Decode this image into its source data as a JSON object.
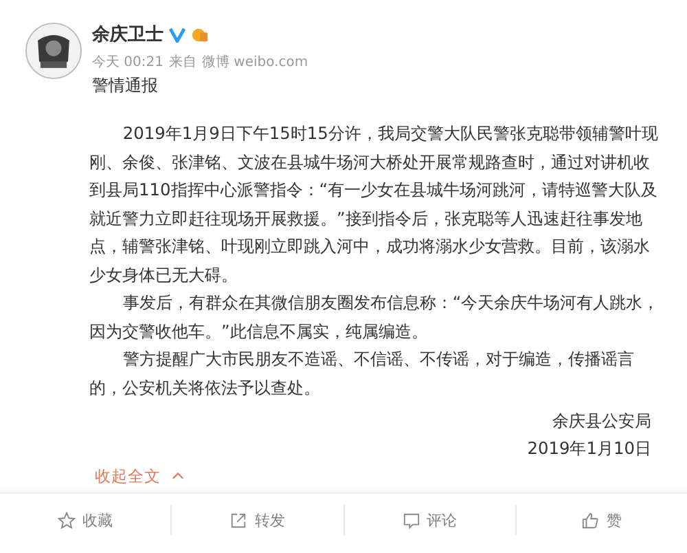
{
  "post": {
    "author": "余庆卫士",
    "verified": true,
    "time": "今天 00:21",
    "source_prefix": "来自",
    "source": "微博 weibo.com",
    "title": "警情通报",
    "paragraphs": [
      "2019年1月9日下午15时15分许，我局交警大队民警张克聪带领辅警叶现刚、余俊、张津铭、文波在县城牛场河大桥处开展常规路查时，通过对讲机收到县局110指挥中心派警指令：“有一少女在县城牛场河跳河，请特巡警大队及就近警力立即赶往现场开展救援。”接到指令后，张克聪等人迅速赶往事发地点，辅警张津铭、叶现刚立即跳入河中，成功将溺水少女营救。目前，该溺水少女身体已无大碍。",
      "事发后，有群众在其微信朋友圈发布信息称：“今天余庆牛场河有人跳水，因为交警收他车。”此信息不属实，纯属编造。",
      "警方提醒广大市民朋友不造谣、不信谣、不传谣，对于编造，传播谣言的，公安机关将依法予以查处。"
    ],
    "signature": "余庆县公安局",
    "date": "2019年1月10日",
    "collapse": "收起全文"
  },
  "actions": [
    {
      "kind": "favorite",
      "label": "收藏"
    },
    {
      "kind": "repost",
      "label": "转发"
    },
    {
      "kind": "comment",
      "label": "评论"
    },
    {
      "kind": "like",
      "label": "赞"
    }
  ]
}
